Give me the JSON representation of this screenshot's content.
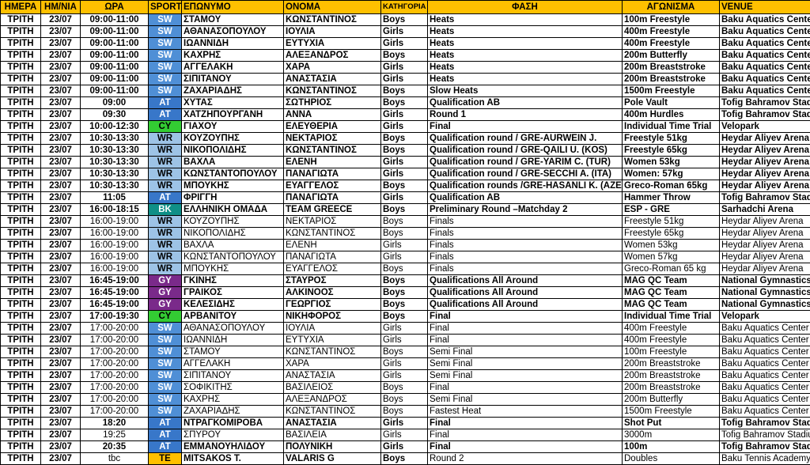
{
  "headers": [
    "ΗΜΕΡΑ",
    "ΗΜ/ΝΙΑ",
    "ΩΡΑ",
    "SPORT",
    "ΕΠΩΝΥΜΟ",
    "ΟΝΟΜΑ",
    "ΚΑΤΗΓΟΡΙΑ",
    "ΦΑΣΗ",
    "ΑΓΩΝΙΣΜΑ",
    "VENUE"
  ],
  "sport_colors": {
    "SW": "#4f8fd6",
    "AT": "#3877c9",
    "CY": "#33cc33",
    "WR": "#9dc3e6",
    "BK": "#0f8f87",
    "GY": "#7a2a8a",
    "TE": "#ffc000"
  },
  "header_color": "#ffc000",
  "rows": [
    {
      "day": "ΤΡΙΤΗ",
      "date": "23/07",
      "time": "09:00-11:00",
      "sport": "SW",
      "surname": "ΣΤΑΜΟΥ",
      "name": "ΚΩΝΣΤΑΝΤΙΝΟΣ",
      "cat": "Boys",
      "phase": "Heats",
      "event": "100m Freestyle",
      "venue": "Baku Aquatics Center",
      "bold": true
    },
    {
      "day": "ΤΡΙΤΗ",
      "date": "23/07",
      "time": "09:00-11:00",
      "sport": "SW",
      "surname": "ΑΘΑΝΑΣΟΠΟΥΛΟΥ",
      "name": "ΙΟΥΛΙΑ",
      "cat": "Girls",
      "phase": "Heats",
      "event": "400m Freestyle",
      "venue": "Baku Aquatics Center",
      "bold": true
    },
    {
      "day": "ΤΡΙΤΗ",
      "date": "23/07",
      "time": "09:00-11:00",
      "sport": "SW",
      "surname": "ΙΩΑΝΝΙΔΗ",
      "name": "ΕΥΤΥΧΙΑ",
      "cat": "Girls",
      "phase": "Heats",
      "event": "400m Freestyle",
      "venue": "Baku Aquatics Center",
      "bold": true
    },
    {
      "day": "ΤΡΙΤΗ",
      "date": "23/07",
      "time": "09:00-11:00",
      "sport": "SW",
      "surname": "ΚΑΧΡΗΣ",
      "name": "ΑΛΕΞΑΝΔΡΟΣ",
      "cat": "Boys",
      "phase": "Heats",
      "event": "200m Butterfly",
      "venue": "Baku Aquatics Center",
      "bold": true
    },
    {
      "day": "ΤΡΙΤΗ",
      "date": "23/07",
      "time": "09:00-11:00",
      "sport": "SW",
      "surname": "ΑΓΓΕΛΑΚΗ",
      "name": "ΧΑΡΑ",
      "cat": "Girls",
      "phase": "Heats",
      "event": "200m Breaststroke",
      "venue": "Baku Aquatics Center",
      "bold": true
    },
    {
      "day": "ΤΡΙΤΗ",
      "date": "23/07",
      "time": "09:00-11:00",
      "sport": "SW",
      "surname": "ΣΙΠΙΤΑΝΟΥ",
      "name": "ΑΝΑΣΤΑΣΙΑ",
      "cat": "Girls",
      "phase": "Heats",
      "event": "200m Breaststroke",
      "venue": "Baku Aquatics Center",
      "bold": true
    },
    {
      "day": "ΤΡΙΤΗ",
      "date": "23/07",
      "time": "09:00-11:00",
      "sport": "SW",
      "surname": "ΖΑΧΑΡΙΑΔΗΣ",
      "name": "ΚΩΝΣΤΑΝΤΙΝΟΣ",
      "cat": "Boys",
      "phase": "Slow Heats",
      "event": "1500m Freestyle",
      "venue": "Baku Aquatics Center",
      "bold": true
    },
    {
      "day": "ΤΡΙΤΗ",
      "date": "23/07",
      "time": "09:00",
      "sport": "AT",
      "surname": "ΧΥΤΑΣ",
      "name": "ΣΩΤΗΡΙΟΣ",
      "cat": "Boys",
      "phase": "Qualification AB",
      "event": "Pole Vault",
      "venue": "Tofig Bahramov Stadium",
      "bold": true
    },
    {
      "day": "ΤΡΙΤΗ",
      "date": "23/07",
      "time": "09:30",
      "sport": "AT",
      "surname": "ΧΑΤΖΗΠΟΥΡΓΑΝΗ",
      "name": "ΑΝΝΑ",
      "cat": "Girls",
      "phase": "Round 1",
      "event": "400m Hurdles",
      "venue": "Tofig Bahramov Stadium",
      "bold": true
    },
    {
      "day": "ΤΡΙΤΗ",
      "date": "23/07",
      "time": "10:00-12:30",
      "sport": "CY",
      "surname": "ΓΙΑΧΟΥ",
      "name": "ΕΛΕΥΘΕΡΙΑ",
      "cat": "Girls",
      "phase": "Final",
      "event": "Individual Time Trial",
      "venue": "Velopark",
      "bold": true
    },
    {
      "day": "ΤΡΙΤΗ",
      "date": "23/07",
      "time": "10:30-13:30",
      "sport": "WR",
      "surname": "ΚΟΥΖΟΥΠΗΣ",
      "name": "ΝΕΚΤΑΡΙΟΣ",
      "cat": "Boys",
      "phase": "Qualification round / GRE-AURWEIN J.",
      "event": "Freestyle 51kg",
      "venue": "Heydar Aliyev Arena",
      "bold": true
    },
    {
      "day": "ΤΡΙΤΗ",
      "date": "23/07",
      "time": "10:30-13:30",
      "sport": "WR",
      "surname": "ΝΙΚΟΠΟΛΙΔΗΣ",
      "name": "ΚΩΝΣΤΑΝΤΙΝΟΣ",
      "cat": "Boys",
      "phase": "Qualification round / GRE-QAILI U. (KOS)",
      "event": "Freestyle 65kg",
      "venue": "Heydar Aliyev Arena",
      "bold": true
    },
    {
      "day": "ΤΡΙΤΗ",
      "date": "23/07",
      "time": "10:30-13:30",
      "sport": "WR",
      "surname": "ΒΑΧΛΑ",
      "name": "ΕΛΕΝΗ",
      "cat": "Girls",
      "phase": "Qualification round / GRE-YARIM C. (TUR)",
      "event": "Women 53kg",
      "venue": "Heydar Aliyev Arena",
      "bold": true
    },
    {
      "day": "ΤΡΙΤΗ",
      "date": "23/07",
      "time": "10:30-13:30",
      "sport": "WR",
      "surname": "ΚΩΝΣΤΑΝΤΟΠΟΥΛΟΥ",
      "name": "ΠΑΝΑΓΙΩΤΑ",
      "cat": "Girls",
      "phase": "Qualification round / GRE-SECCHI A. (ITA)",
      "event": "Women: 57kg",
      "venue": "Heydar Aliyev Arena",
      "bold": true
    },
    {
      "day": "ΤΡΙΤΗ",
      "date": "23/07",
      "time": "10:30-13:30",
      "sport": "WR",
      "surname": "ΜΠΟΥΚΗΣ",
      "name": "ΕΥΑΓΓΕΛΟΣ",
      "cat": "Boys",
      "phase": "Qualification rounds /GRE-HASANLI K. (AZE)",
      "event": "Greco-Roman 65kg",
      "venue": "Heydar Aliyev Arena",
      "bold": true
    },
    {
      "day": "ΤΡΙΤΗ",
      "date": "23/07",
      "time": "11:05",
      "sport": "AT",
      "surname": "ΦΡΙΓΓΗ",
      "name": "ΠΑΝΑΓΙΩΤΑ",
      "cat": "Girls",
      "phase": "Qualification AB",
      "event": "Hammer Throw",
      "venue": "Tofig Bahramov Stadium",
      "bold": true
    },
    {
      "day": "ΤΡΙΤΗ",
      "date": "23/07",
      "time": "16:00-18:15",
      "sport": "BK",
      "surname": "ΕΛΛΗΝΙΚΗ ΟΜΑΔΑ",
      "name": "TEAM GREECE",
      "cat": "Boys",
      "phase": "Preliminary Round –Matchday 2",
      "event": "ESP - GRE",
      "venue": "Sarhadchi Arena",
      "bold": true
    },
    {
      "day": "ΤΡΙΤΗ",
      "date": "23/07",
      "time": "16:00-19:00",
      "sport": "WR",
      "surname": "ΚΟΥΖΟΥΠΗΣ",
      "name": "ΝΕΚΤΑΡΙΟΣ",
      "cat": "Boys",
      "phase": "Finals",
      "event": "Freestyle 51kg",
      "venue": "Heydar Aliyev Arena",
      "bold": false
    },
    {
      "day": "ΤΡΙΤΗ",
      "date": "23/07",
      "time": "16:00-19:00",
      "sport": "WR",
      "surname": "ΝΙΚΟΠΟΛΙΔΗΣ",
      "name": "ΚΩΝΣΤΑΝΤΙΝΟΣ",
      "cat": "Boys",
      "phase": "Finals",
      "event": "Freestyle 65kg",
      "venue": "Heydar Aliyev Arena",
      "bold": false
    },
    {
      "day": "ΤΡΙΤΗ",
      "date": "23/07",
      "time": "16:00-19:00",
      "sport": "WR",
      "surname": "ΒΑΧΛΑ",
      "name": "ΕΛΕΝΗ",
      "cat": "Girls",
      "phase": "Finals",
      "event": "Women 53kg",
      "venue": "Heydar Aliyev Arena",
      "bold": false
    },
    {
      "day": "ΤΡΙΤΗ",
      "date": "23/07",
      "time": "16:00-19:00",
      "sport": "WR",
      "surname": "ΚΩΝΣΤΑΝΤΟΠΟΥΛΟΥ",
      "name": "ΠΑΝΑΓΙΩΤΑ",
      "cat": "Girls",
      "phase": "Finals",
      "event": "Women 57kg",
      "venue": "Heydar Aliyev Arena",
      "bold": false
    },
    {
      "day": "ΤΡΙΤΗ",
      "date": "23/07",
      "time": "16:00-19:00",
      "sport": "WR",
      "surname": "ΜΠΟΥΚΗΣ",
      "name": "ΕΥΑΓΓΕΛΟΣ",
      "cat": "Boys",
      "phase": "Finals",
      "event": "Greco-Roman 65 kg",
      "venue": "Heydar Aliyev Arena",
      "bold": false
    },
    {
      "day": "ΤΡΙΤΗ",
      "date": "23/07",
      "time": "16:45-19:00",
      "sport": "GY",
      "surname": "ΓΚΙΝΗΣ",
      "name": "ΣΤΑΥΡΟΣ",
      "cat": "Boys",
      "phase": "Qualifications All Around",
      "event": "MAG QC Team",
      "venue": "National Gymnastics",
      "bold": true
    },
    {
      "day": "ΤΡΙΤΗ",
      "date": "23/07",
      "time": "16:45-19:00",
      "sport": "GY",
      "surname": "ΓΡΑΙΚΟΣ",
      "name": "ΑΛΚΙΝΟΟΣ",
      "cat": "Boys",
      "phase": "Qualifications All Around",
      "event": "MAG QC Team",
      "venue": "National Gymnastics",
      "bold": true
    },
    {
      "day": "ΤΡΙΤΗ",
      "date": "23/07",
      "time": "16:45-19:00",
      "sport": "GY",
      "surname": "ΚΕΛΕΣΙΔΗΣ",
      "name": "ΓΕΩΡΓΙΟΣ",
      "cat": "Boys",
      "phase": "Qualifications All Around",
      "event": "MAG QC Team",
      "venue": "National Gymnastics",
      "bold": true
    },
    {
      "day": "ΤΡΙΤΗ",
      "date": "23/07",
      "time": "17:00-19:30",
      "sport": "CY",
      "surname": "ΑΡΒΑΝΙΤΟΥ",
      "name": "ΝΙΚΗΦΟΡΟΣ",
      "cat": "Boys",
      "phase": "Final",
      "event": "Individual Time Trial",
      "venue": "Velopark",
      "bold": true
    },
    {
      "day": "ΤΡΙΤΗ",
      "date": "23/07",
      "time": "17:00-20:00",
      "sport": "SW",
      "surname": "ΑΘΑΝΑΣΟΠΟΥΛΟΥ",
      "name": "ΙΟΥΛΙΑ",
      "cat": "Girls",
      "phase": "Final",
      "event": "400m Freestyle",
      "venue": "Baku Aquatics Center",
      "bold": false
    },
    {
      "day": "ΤΡΙΤΗ",
      "date": "23/07",
      "time": "17:00-20:00",
      "sport": "SW",
      "surname": "ΙΩΑΝΝΙΔΗ",
      "name": "ΕΥΤΥΧΙΑ",
      "cat": "Girls",
      "phase": "Final",
      "event": "400m Freestyle",
      "venue": "Baku Aquatics Center",
      "bold": false
    },
    {
      "day": "ΤΡΙΤΗ",
      "date": "23/07",
      "time": "17:00-20:00",
      "sport": "SW",
      "surname": "ΣΤΑΜΟΥ",
      "name": "ΚΩΝΣΤΑΝΤΙΝΟΣ",
      "cat": "Boys",
      "phase": "Semi Final",
      "event": "100m Freestyle",
      "venue": "Baku Aquatics Center",
      "bold": false
    },
    {
      "day": "ΤΡΙΤΗ",
      "date": "23/07",
      "time": "17:00-20:00",
      "sport": "SW",
      "surname": "ΑΓΓΕΛΑΚΗ",
      "name": "ΧΑΡΑ",
      "cat": "Girls",
      "phase": "Semi Final",
      "event": "200m Breaststroke",
      "venue": "Baku Aquatics Center",
      "bold": false
    },
    {
      "day": "ΤΡΙΤΗ",
      "date": "23/07",
      "time": "17:00-20:00",
      "sport": "SW",
      "surname": "ΣΙΠΙΤΑΝΟΥ",
      "name": "ΑΝΑΣΤΑΣΙΑ",
      "cat": "Girls",
      "phase": "Semi Final",
      "event": "200m Breaststroke",
      "venue": "Baku Aquatics Center",
      "bold": false
    },
    {
      "day": "ΤΡΙΤΗ",
      "date": "23/07",
      "time": "17:00-20:00",
      "sport": "SW",
      "surname": "ΣΟΦΙΚΙΤΗΣ",
      "name": "ΒΑΣΙΛΕΙΟΣ",
      "cat": "Boys",
      "phase": "Final",
      "event": "200m Breaststroke",
      "venue": "Baku Aquatics Center",
      "bold": false
    },
    {
      "day": "ΤΡΙΤΗ",
      "date": "23/07",
      "time": "17:00-20:00",
      "sport": "SW",
      "surname": "ΚΑΧΡΗΣ",
      "name": "ΑΛΕΞΑΝΔΡΟΣ",
      "cat": "Boys",
      "phase": "Semi Final",
      "event": "200m Butterfly",
      "venue": "Baku Aquatics Center",
      "bold": false
    },
    {
      "day": "ΤΡΙΤΗ",
      "date": "23/07",
      "time": "17:00-20:00",
      "sport": "SW",
      "surname": "ΖΑΧΑΡΙΑΔΗΣ",
      "name": "ΚΩΝΣΤΑΝΤΙΝΟΣ",
      "cat": "Boys",
      "phase": "Fastest Heat",
      "event": "1500m Freestyle",
      "venue": "Baku Aquatics Center",
      "bold": false
    },
    {
      "day": "ΤΡΙΤΗ",
      "date": "23/07",
      "time": "18:20",
      "sport": "AT",
      "surname": "ΝΤΡΑΓΚΟΜΙΡΟΒΑ",
      "name": "ΑΝΑΣΤΑΣΙΑ",
      "cat": "Girls",
      "phase": "Final",
      "event": "Shot Put",
      "venue": "Tofig Bahramov Stadium",
      "bold": true
    },
    {
      "day": "ΤΡΙΤΗ",
      "date": "23/07",
      "time": "19:25",
      "sport": "AT",
      "surname": "ΣΠΥΡΟΥ",
      "name": "ΒΑΣΙΛΕΙΑ",
      "cat": "Girls",
      "phase": "Final",
      "event": "3000m",
      "venue": "Tofig Bahramov Stadium",
      "bold": false
    },
    {
      "day": "ΤΡΙΤΗ",
      "date": "23/07",
      "time": "20:35",
      "sport": "AT",
      "surname": "ΕΜΜΑΝΟΥΗΛΙΔΟΥ",
      "name": "ΠΟΛΥΝΙΚΗ",
      "cat": "Girls",
      "phase": "Final",
      "event": "100m",
      "venue": "Tofig Bahramov Stadium",
      "bold": true
    },
    {
      "day": "ΤΡΙΤΗ",
      "date": "23/07",
      "time": "tbc",
      "sport": "TE",
      "surname": "MITSAKOS T.",
      "name": "VALARIS G",
      "cat": "Boys",
      "phase": "Round 2",
      "event": "Doubles",
      "venue": "Baku Tennis Academy",
      "bold": "mixed"
    }
  ]
}
